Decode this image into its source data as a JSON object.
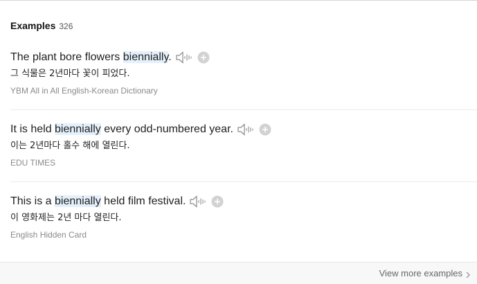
{
  "examples": {
    "title": "Examples",
    "count": "326",
    "items": [
      {
        "before": "The plant bore flowers ",
        "highlight": "biennially",
        "after": ".",
        "translation": "그 식물은 2년마다 꽃이 피었다.",
        "source": "YBM All in All English-Korean Dictionary"
      },
      {
        "before": "It is held ",
        "highlight": "biennially",
        "after": " every odd-numbered year.",
        "translation": "이는 2년마다 홀수 해에 열린다.",
        "source": "EDU TIMES"
      },
      {
        "before": "This is a ",
        "highlight": "biennially",
        "after": " held film festival.",
        "translation": "이 영화제는 2년 마다 열린다.",
        "source": "English Hidden Card"
      }
    ]
  },
  "footer": {
    "view_more_label": "View more examples"
  },
  "icons": {
    "speaker": "speaker-icon",
    "add": "plus-icon",
    "chevron": "chevron-right-icon"
  },
  "colors": {
    "highlight": "#e4f0fb",
    "source_text": "#8a8a8a",
    "icon_gray": "#bdbdbd"
  }
}
